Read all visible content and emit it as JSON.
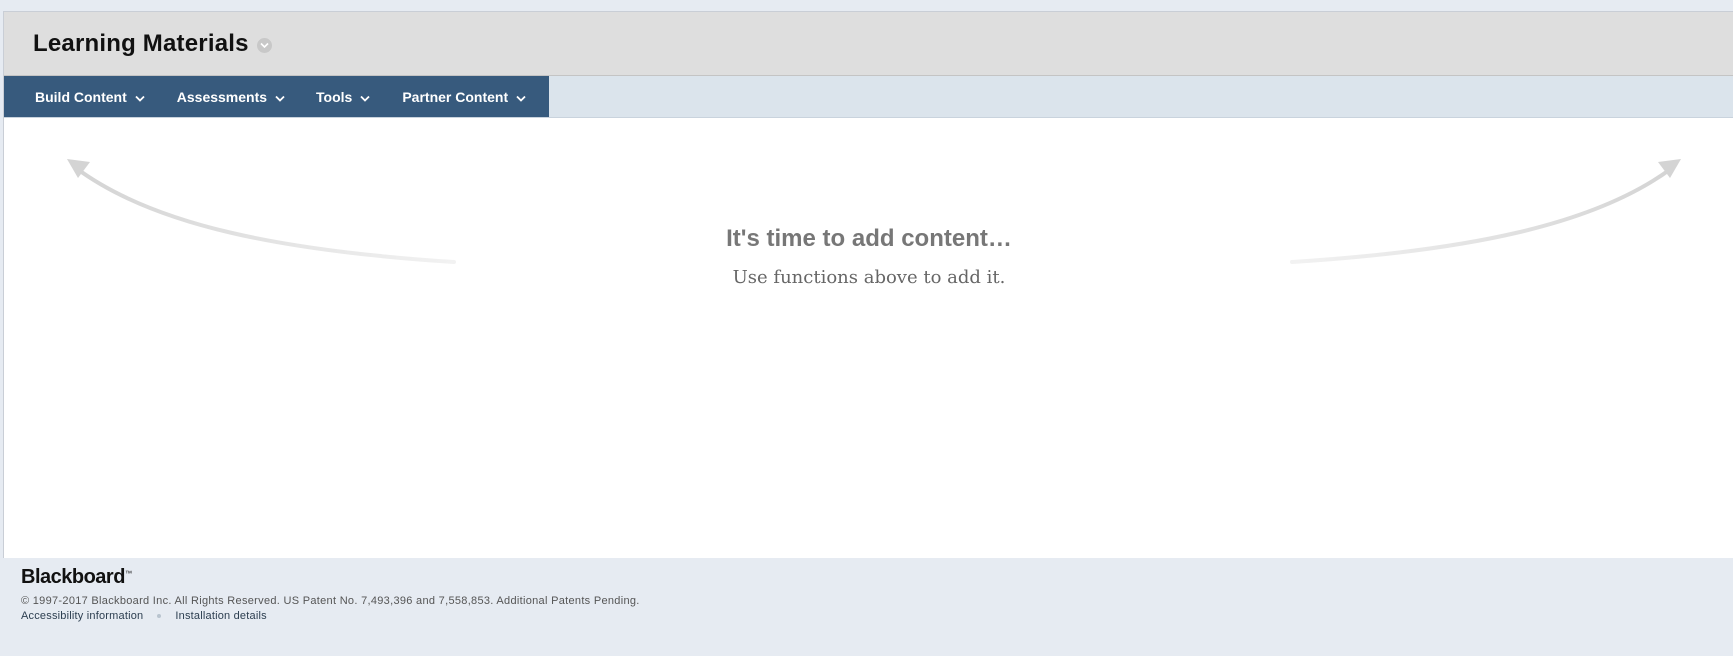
{
  "page": {
    "title": "Learning Materials"
  },
  "action_bar": {
    "items": [
      {
        "label": "Build Content",
        "icon": "chevron-down-icon"
      },
      {
        "label": "Assessments",
        "icon": "chevron-down-icon"
      },
      {
        "label": "Tools",
        "icon": "chevron-down-icon"
      },
      {
        "label": "Partner Content",
        "icon": "chevron-down-icon"
      }
    ]
  },
  "empty_state": {
    "heading": "It's time to add content…",
    "subheading": "Use functions above to add it."
  },
  "footer": {
    "brand": "Blackboard",
    "copyright": "© 1997-2017 Blackboard Inc. All Rights Reserved. US Patent No. 7,493,396 and 7,558,853. Additional Patents Pending.",
    "links": [
      "Accessibility information",
      "Installation details"
    ]
  },
  "colors": {
    "action_bar": "#375a7d",
    "title_bar": "#dedede",
    "menu_row_bg": "#dbe4ec",
    "page_bg": "#e6ebf2"
  }
}
